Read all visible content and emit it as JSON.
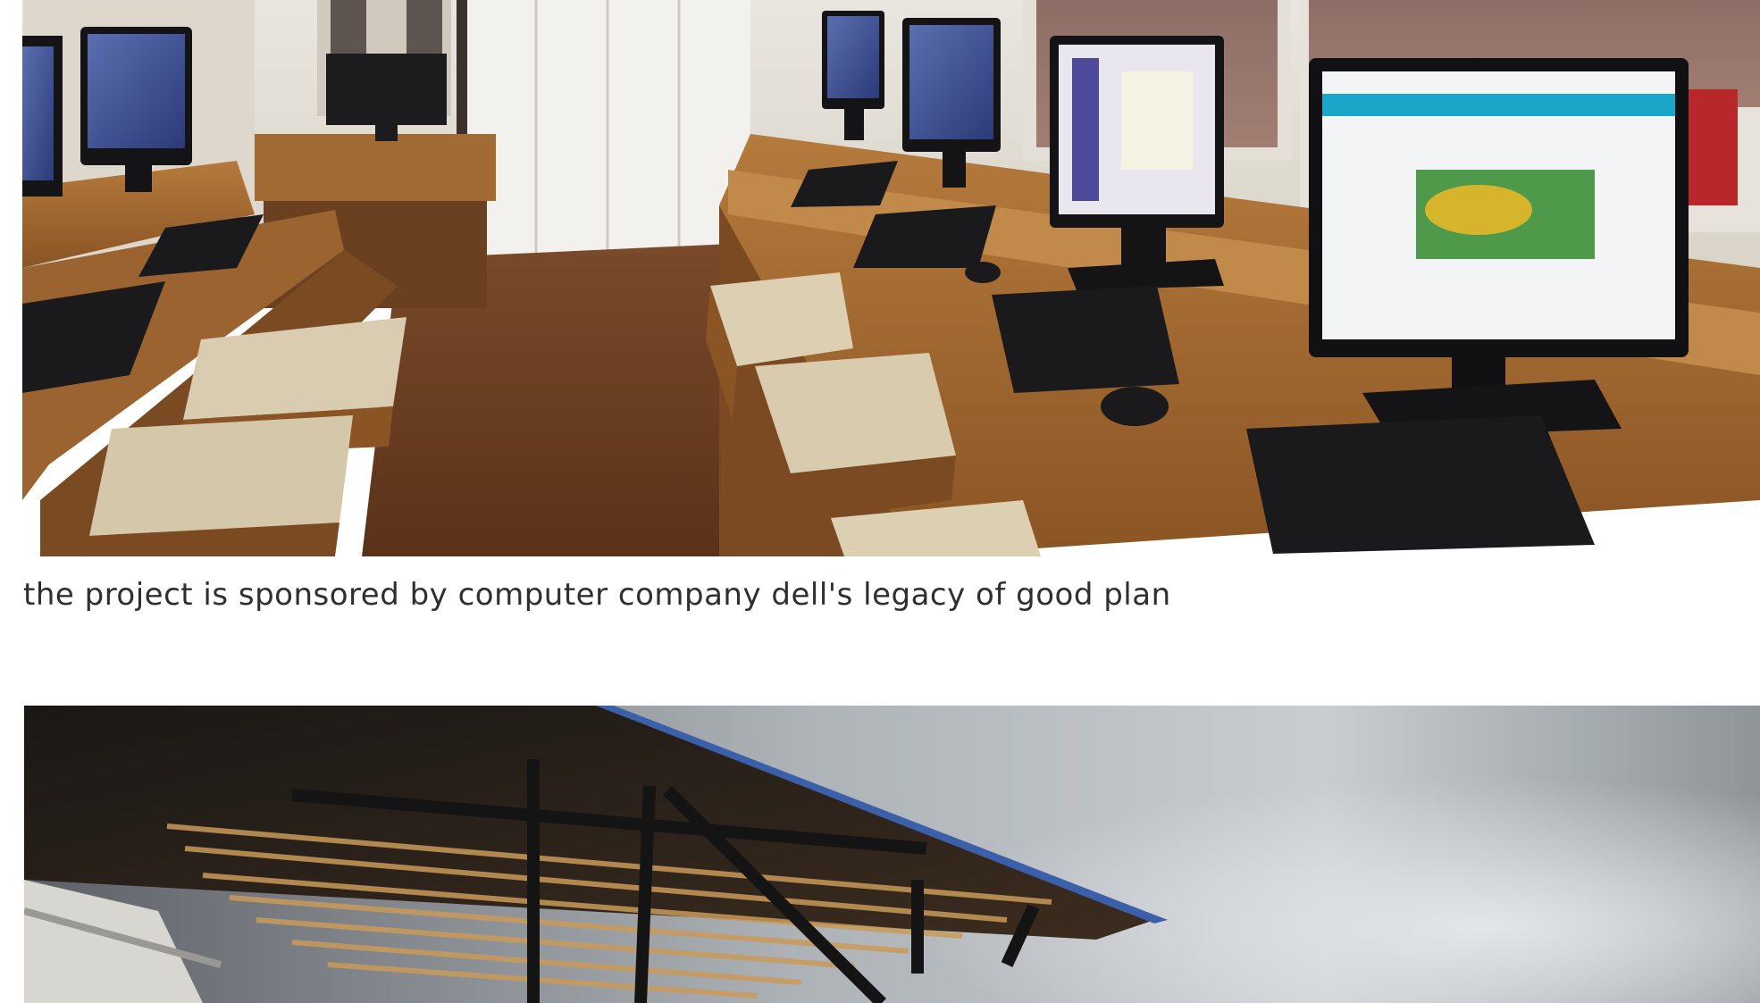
{
  "post": {
    "caption": "the project is sponsored by computer company dell's legacy of good plan"
  },
  "images": [
    {
      "subject": "computer lab with wooden desks, monitors, keyboards and cushioned stools"
    },
    {
      "subject": "underside of a timber-and-steel roof canopy against a cloudy sky"
    }
  ]
}
